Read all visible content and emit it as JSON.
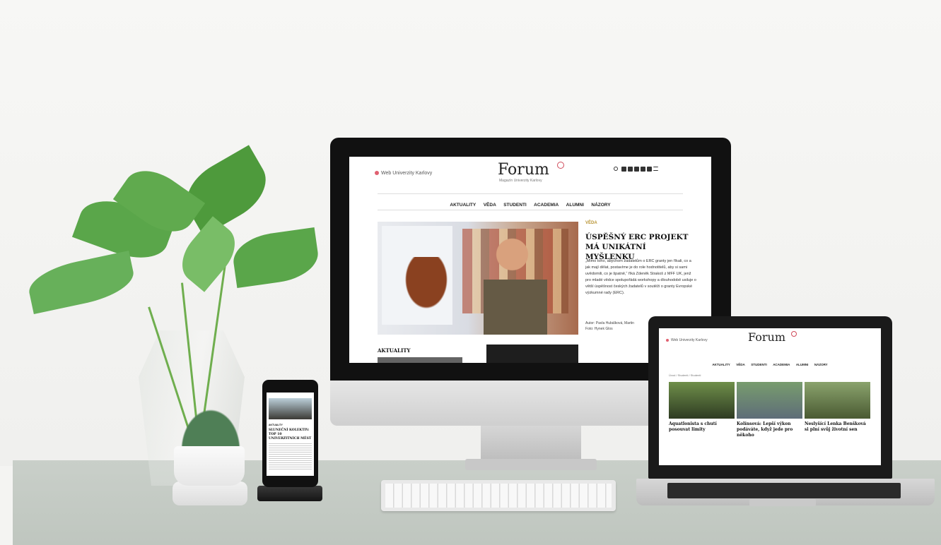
{
  "desktop": {
    "top_link": "Web Univerzity Karlovy",
    "logo": "Forum",
    "logo_subtitle": "Magazín Univerzity Karlovy",
    "nav": [
      "AKTUALITY",
      "VĚDA",
      "STUDENTI",
      "ACADEMIA",
      "ALUMNI",
      "NÁZORY"
    ],
    "kicker": "VĚDA",
    "headline": "ÚSPĚŠNÝ ERC PROJEKT MÁ UNIKÁTNÍ MYŠLENKU",
    "excerpt": "„Mimo toho, abychom žadatelům o ERC granty jen říkali, co a jak mají dělat, postavíme je do role hodnotitelů, aby si sami uvědomili, co je špatně,“ říká Zdeněk Strakoš z MFF UK, jenž pro mladé vědce spolupořádá workshopy a dlouhodobě usiluje o větší úspěšnost českých žadatelů v soutěži o granty Evropské výzkumné rady (ERC).",
    "credits_author": "Autor: Pavla Hubálková, Martin",
    "credits_photo": "Foto: Hynek Glos",
    "section": "AKTUALITY"
  },
  "laptop": {
    "top_link": "Web Univerzity Karlovy",
    "logo": "Forum",
    "logo_subtitle": "Magazín Univerzity Karlovy",
    "nav": [
      "AKTUALITY",
      "VĚDA",
      "STUDENTI",
      "ACADEMIA",
      "ALUMNI",
      "NÁZORY"
    ],
    "breadcrumb": "Úvod / Studenti / Studenti",
    "cards": [
      {
        "title": "Aquatlonista s chutí posouvat limity"
      },
      {
        "title": "Kolínsová: Lepší výkon podáváte, když jede pro někoho"
      },
      {
        "title": "Neslyšící Lenka Benšková si plní svůj životní sen"
      }
    ]
  },
  "phone": {
    "section": "AKTUALITY",
    "headline": "SLUNEČNÍ KOLEKTIV: TOP 10 UNIVERZITNÍCH MĚST"
  },
  "colors": {
    "accent_gold": "#b89434",
    "logo_ring": "#d04a5a"
  }
}
